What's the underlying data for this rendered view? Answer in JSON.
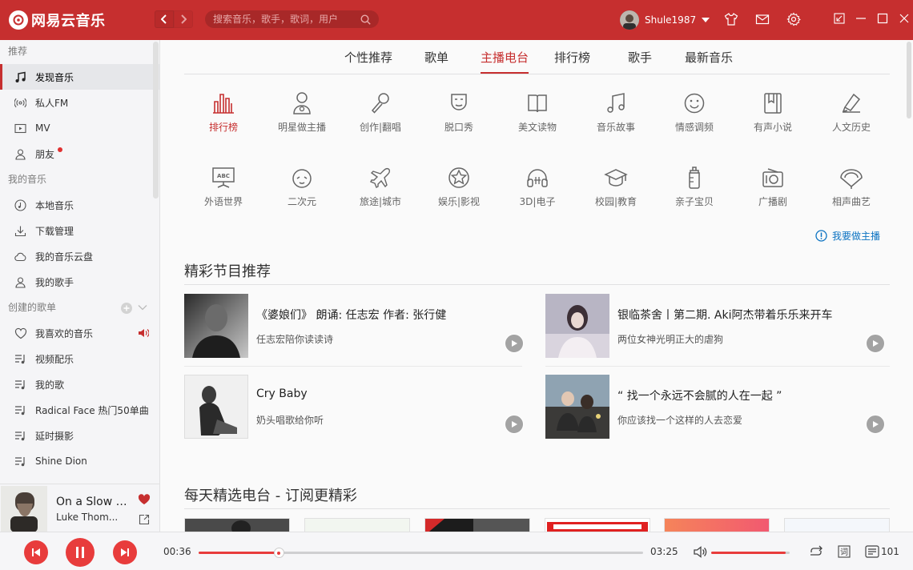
{
  "app": {
    "logo_text": "网易云音乐",
    "accent": "#c62f2f"
  },
  "search": {
    "placeholder": "搜索音乐，歌手，歌词，用户"
  },
  "user": {
    "name": "Shule1987"
  },
  "sidebar": {
    "section_recommend": "推荐",
    "recommend_items": [
      {
        "label": "发现音乐",
        "icon": "music-note-icon",
        "active": true
      },
      {
        "label": "私人FM",
        "icon": "radio-signal-icon"
      },
      {
        "label": "MV",
        "icon": "video-icon"
      },
      {
        "label": "朋友",
        "icon": "friends-icon",
        "badge": true
      }
    ],
    "section_my_music": "我的音乐",
    "my_music_items": [
      {
        "label": "本地音乐",
        "icon": "local-music-icon"
      },
      {
        "label": "下载管理",
        "icon": "download-icon"
      },
      {
        "label": "我的音乐云盘",
        "icon": "cloud-icon"
      },
      {
        "label": "我的歌手",
        "icon": "singer-icon"
      }
    ],
    "section_created": "创建的歌单",
    "playlists": [
      {
        "label": "我喜欢的音乐",
        "icon": "heart-icon"
      },
      {
        "label": "视频配乐",
        "icon": "playlist-icon"
      },
      {
        "label": "我的歌",
        "icon": "playlist-icon"
      },
      {
        "label": "Radical Face 热门50单曲",
        "icon": "playlist-icon"
      },
      {
        "label": "延时摄影",
        "icon": "playlist-icon"
      },
      {
        "label": "Shine Dion",
        "icon": "playlist-icon"
      }
    ]
  },
  "now_playing": {
    "title": "On a Slow B...",
    "artist": "Luke Thom..."
  },
  "tabs": [
    {
      "label": "个性推荐"
    },
    {
      "label": "歌单"
    },
    {
      "label": "主播电台",
      "active": true
    },
    {
      "label": "排行榜"
    },
    {
      "label": "歌手"
    },
    {
      "label": "最新音乐"
    }
  ],
  "categories_row1": [
    {
      "label": "排行榜",
      "icon": "chart-bars-icon",
      "active": true
    },
    {
      "label": "明星做主播",
      "icon": "star-host-icon"
    },
    {
      "label": "创作|翻唱",
      "icon": "microphone-icon"
    },
    {
      "label": "脱口秀",
      "icon": "mask-icon"
    },
    {
      "label": "美文读物",
      "icon": "book-icon"
    },
    {
      "label": "音乐故事",
      "icon": "music-story-icon"
    },
    {
      "label": "情感调频",
      "icon": "smile-icon"
    },
    {
      "label": "有声小说",
      "icon": "audiobook-icon"
    },
    {
      "label": "人文历史",
      "icon": "history-icon"
    }
  ],
  "categories_row2": [
    {
      "label": "外语世界",
      "icon": "abc-board-icon"
    },
    {
      "label": "二次元",
      "icon": "anime-face-icon"
    },
    {
      "label": "旅途|城市",
      "icon": "airplane-icon"
    },
    {
      "label": "娱乐|影视",
      "icon": "star-badge-icon"
    },
    {
      "label": "3D|电子",
      "icon": "headphones-icon"
    },
    {
      "label": "校园|教育",
      "icon": "graduation-cap-icon"
    },
    {
      "label": "亲子宝贝",
      "icon": "baby-bottle-icon"
    },
    {
      "label": "广播剧",
      "icon": "radio-icon"
    },
    {
      "label": "相声曲艺",
      "icon": "fan-icon"
    }
  ],
  "apply_host": "我要做主播",
  "section_programs": "精彩节目推荐",
  "programs": [
    {
      "title": "《婆娘们》 朗诵: 任志宏 作者: 张行健",
      "subtitle": "任志宏陪你读读诗"
    },
    {
      "title": "银临茶舍丨第二期. Aki阿杰带着乐乐来开车",
      "subtitle": "两位女神光明正大的虐狗"
    },
    {
      "title": "Cry Baby",
      "subtitle": "奶头唱歌给你听"
    },
    {
      "title": "“ 找一个永远不会腻的人在一起 ”",
      "subtitle": "你应该找一个这样的人去恋爱"
    }
  ],
  "section_daily": "每天精选电台 - 订阅更精彩",
  "player": {
    "current_time": "00:36",
    "total_time": "03:25",
    "progress": 0.18,
    "volume": 0.95,
    "playlist_count": "101"
  }
}
